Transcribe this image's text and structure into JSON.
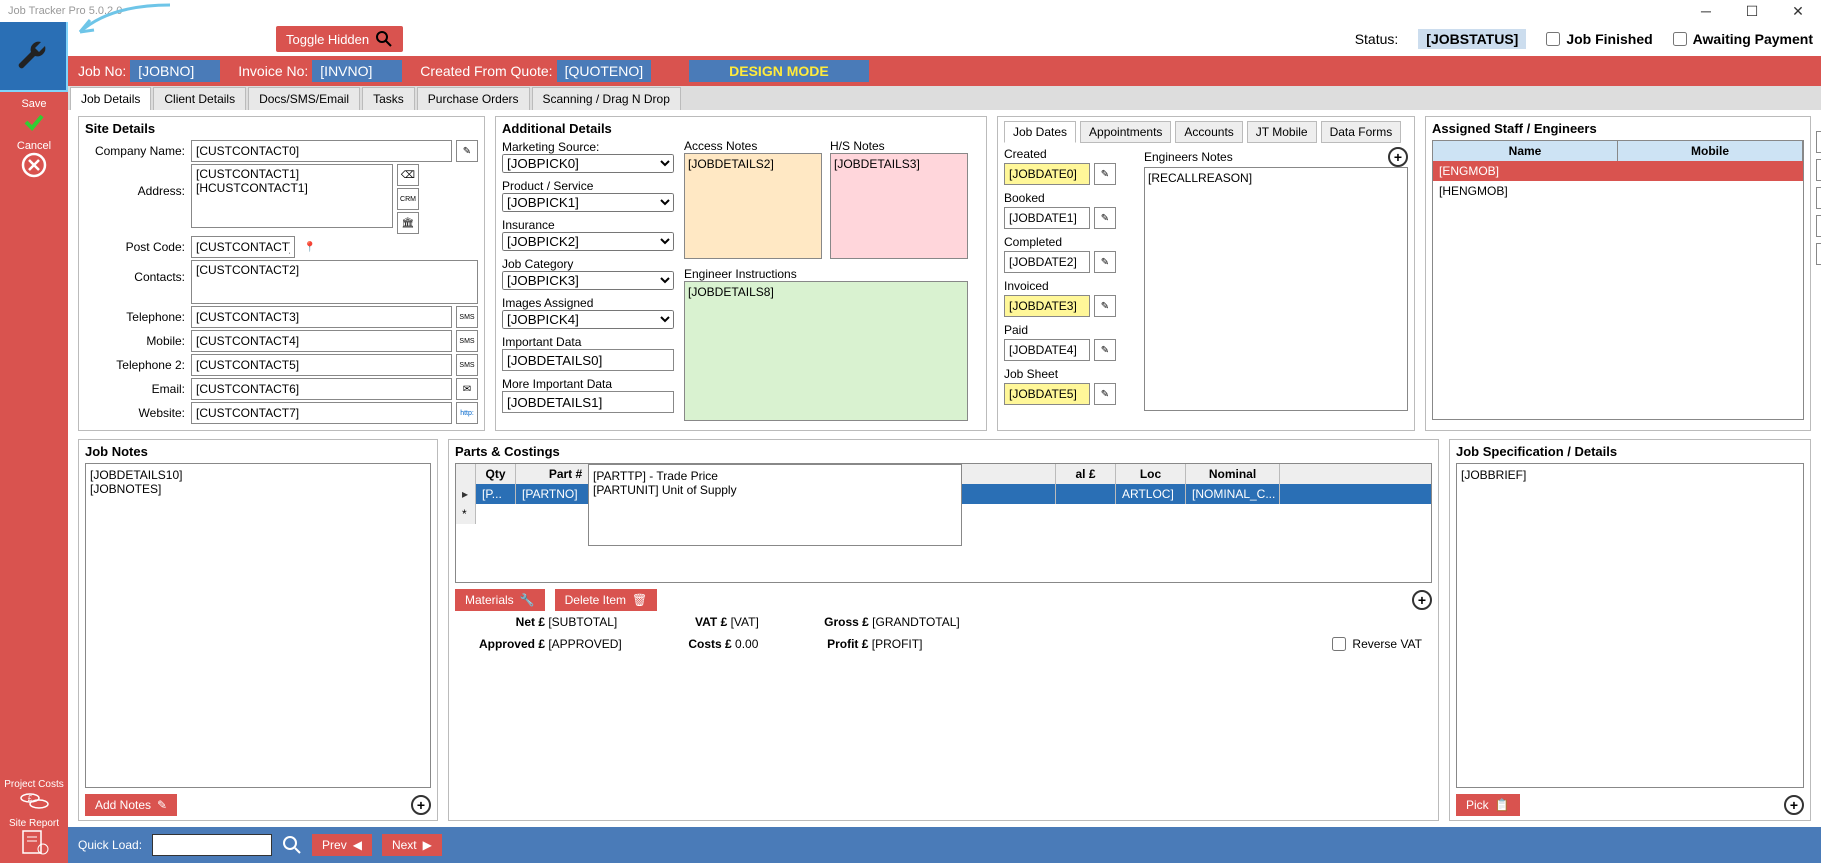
{
  "titlebar": "Job Tracker Pro 5.0.2.0",
  "toggle_hidden": "Toggle Hidden",
  "status_label": "Status:",
  "status_value": "[JOBSTATUS]",
  "chk_job_finished": "Job Finished",
  "chk_awaiting_payment": "Awaiting Payment",
  "rail": {
    "save": "Save",
    "cancel": "Cancel",
    "project_costs": "Project Costs",
    "site_report": "Site Report"
  },
  "header": {
    "jobno_label": "Job No:",
    "jobno": "[JOBNO]",
    "invno_label": "Invoice No:",
    "invno": "[INVNO]",
    "quote_label": "Created From Quote:",
    "quote": "[QUOTENO]",
    "design_mode": "DESIGN MODE"
  },
  "tabs": [
    "Job Details",
    "Client Details",
    "Docs/SMS/Email",
    "Tasks",
    "Purchase Orders",
    "Scanning / Drag N Drop"
  ],
  "site": {
    "title": "Site Details",
    "company_label": "Company Name:",
    "company": "[CUSTCONTACT0]",
    "address_label": "Address:",
    "address": "[CUSTCONTACT1]\n[HCUSTCONTACT1]",
    "postcode_label": "Post Code:",
    "postcode": "[CUSTCONTACT]",
    "contacts_label": "Contacts:",
    "contacts": "[CUSTCONTACT2]",
    "tel_label": "Telephone:",
    "tel": "[CUSTCONTACT3]",
    "mob_label": "Mobile:",
    "mob": "[CUSTCONTACT4]",
    "tel2_label": "Telephone 2:",
    "tel2": "[CUSTCONTACT5]",
    "email_label": "Email:",
    "email": "[CUSTCONTACT6]",
    "web_label": "Website:",
    "web": "[CUSTCONTACT7]"
  },
  "additional": {
    "title": "Additional Details",
    "marketing_label": "Marketing Source:",
    "marketing": "[JOBPICK0]",
    "product_label": "Product / Service",
    "product": "[JOBPICK1]",
    "insurance_label": "Insurance",
    "insurance": "[JOBPICK2]",
    "category_label": "Job Category",
    "category": "[JOBPICK3]",
    "images_label": "Images Assigned",
    "images": "[JOBPICK4]",
    "important_label": "Important Data",
    "important": "[JOBDETAILS0]",
    "moreimportant_label": "More Important Data",
    "moreimportant": "[JOBDETAILS1]",
    "access_label": "Access Notes",
    "access": "[JOBDETAILS2]",
    "hs_label": "H/S Notes",
    "hs": "[JOBDETAILS3]",
    "enginstr_label": "Engineer Instructions",
    "enginstr": "[JOBDETAILS8]"
  },
  "dates": {
    "tabs": [
      "Job Dates",
      "Appointments",
      "Accounts",
      "JT Mobile",
      "Data Forms"
    ],
    "created_label": "Created",
    "created": "[JOBDATE0]",
    "booked_label": "Booked",
    "booked": "[JOBDATE1]",
    "completed_label": "Completed",
    "completed": "[JOBDATE2]",
    "invoiced_label": "Invoiced",
    "invoiced": "[JOBDATE3]",
    "paid_label": "Paid",
    "paid": "[JOBDATE4]",
    "jobsheet_label": "Job Sheet",
    "jobsheet": "[JOBDATE5]",
    "engnotes_label": "Engineers Notes",
    "engnotes": "[RECALLREASON]"
  },
  "staff": {
    "title": "Assigned Staff / Engineers",
    "col_name": "Name",
    "col_mobile": "Mobile",
    "row1": "[ENGMOB]",
    "row2": "[HENGMOB]"
  },
  "notes": {
    "title": "Job Notes",
    "text": "[JOBDETAILS10]\n[JOBNOTES]",
    "add_btn": "Add Notes"
  },
  "parts": {
    "title": "Parts & Costings",
    "tooltip_line1": "[PARTTP] - Trade Price",
    "tooltip_line2": "[PARTUNIT] Unit of Supply",
    "col_qty": "Qty",
    "col_part": "Part #",
    "col_total": "al £",
    "col_loc": "Loc",
    "col_nominal": "Nominal",
    "row_qty": "[P...",
    "row_part": "[PARTNO]",
    "row_loc": "ARTLOC]",
    "row_nom": "[NOMINAL_C...",
    "materials_btn": "Materials",
    "delete_btn": "Delete Item",
    "net_label": "Net £",
    "net": "[SUBTOTAL]",
    "vat_label": "VAT £",
    "vat": "[VAT]",
    "gross_label": "Gross £",
    "gross": "[GRANDTOTAL]",
    "approved_label": "Approved £",
    "approved": "[APPROVED]",
    "costs_label": "Costs £",
    "costs": "0.00",
    "profit_label": "Profit £",
    "profit": "[PROFIT]",
    "reverse_vat": "Reverse VAT"
  },
  "spec": {
    "title": "Job Specification / Details",
    "text": "[JOBBRIEF]",
    "pick_btn": "Pick"
  },
  "footer": {
    "quickload": "Quick Load:",
    "prev": "Prev",
    "next": "Next"
  }
}
